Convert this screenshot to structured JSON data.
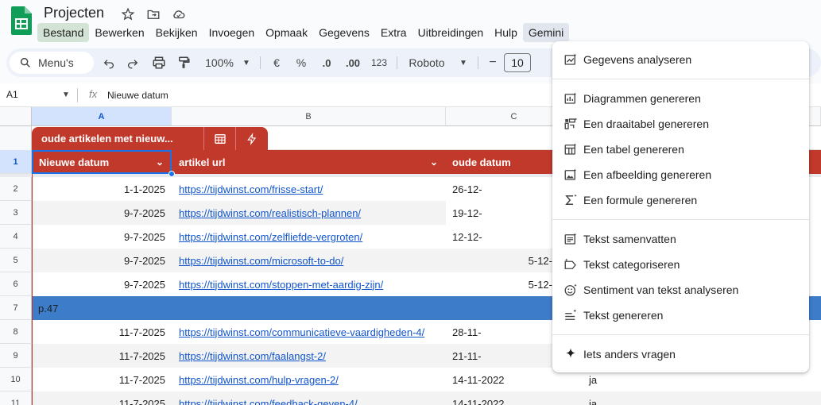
{
  "doc": {
    "title": "Projecten"
  },
  "menubar": [
    "Bestand",
    "Bewerken",
    "Bekijken",
    "Invoegen",
    "Opmaak",
    "Gegevens",
    "Extra",
    "Uitbreidingen",
    "Hulp",
    "Gemini"
  ],
  "toolbar": {
    "search_label": "Menu's",
    "zoom": "100%",
    "currency": "€",
    "percent": "%",
    "decrease_decimals": ".0",
    "increase_decimals": ".00",
    "number_format": "123",
    "font": "Roboto",
    "minus": "−",
    "font_size": "10"
  },
  "formula_bar": {
    "cell_ref": "A1",
    "fx": "fx",
    "content": "Nieuwe datum"
  },
  "columns": [
    "A",
    "B",
    "C"
  ],
  "table": {
    "name": "oude artikelen met nieuw...",
    "headers": [
      "Nieuwe datum",
      "artikel url",
      "oude datum"
    ]
  },
  "rows": [
    {
      "num": "1"
    },
    {
      "num": "2",
      "a": "1-1-2025",
      "b": "https://tijdwinst.com/frisse-start/",
      "c": "26-12-"
    },
    {
      "num": "3",
      "a": "9-7-2025",
      "b": "https://tijdwinst.com/realistisch-plannen/",
      "c": "19-12-"
    },
    {
      "num": "4",
      "a": "9-7-2025",
      "b": "https://tijdwinst.com/zelfliefde-vergroten/",
      "c": "12-12-"
    },
    {
      "num": "5",
      "a": "9-7-2025",
      "b": "https://tijdwinst.com/microsoft-to-do/",
      "c": "5-12-"
    },
    {
      "num": "6",
      "a": "9-7-2025",
      "b": "https://tijdwinst.com/stoppen-met-aardig-zijn/",
      "c": "5-12-"
    },
    {
      "num": "7",
      "a": "p.47"
    },
    {
      "num": "8",
      "a": "11-7-2025",
      "b": "https://tijdwinst.com/communicatieve-vaardigheden-4/",
      "c": "28-11-"
    },
    {
      "num": "9",
      "a": "11-7-2025",
      "b": "https://tijdwinst.com/faalangst-2/",
      "c": "21-11-"
    },
    {
      "num": "10",
      "a": "11-7-2025",
      "b": "https://tijdwinst.com/hulp-vragen-2/",
      "c": "14-11-2022",
      "d": "ja"
    },
    {
      "num": "11",
      "a": "11-7-2025",
      "b": "https://tijdwinst.com/feedback-geven-4/",
      "c": "14-11-2022",
      "d": "ja"
    }
  ],
  "gemini_menu": {
    "analyze": "Gegevens analyseren",
    "charts": "Diagrammen genereren",
    "pivot": "Een draaitabel genereren",
    "table": "Een tabel genereren",
    "image": "Een afbeelding genereren",
    "formula": "Een formule genereren",
    "summarize": "Tekst samenvatten",
    "categorize": "Tekst categoriseren",
    "sentiment": "Sentiment van tekst analyseren",
    "generate_text": "Tekst genereren",
    "ask": "Iets anders vragen"
  },
  "colors": {
    "table_header": "#c0392b",
    "group_row": "#3d7cc9",
    "selection": "#1a73e8",
    "link": "#1155cc"
  }
}
